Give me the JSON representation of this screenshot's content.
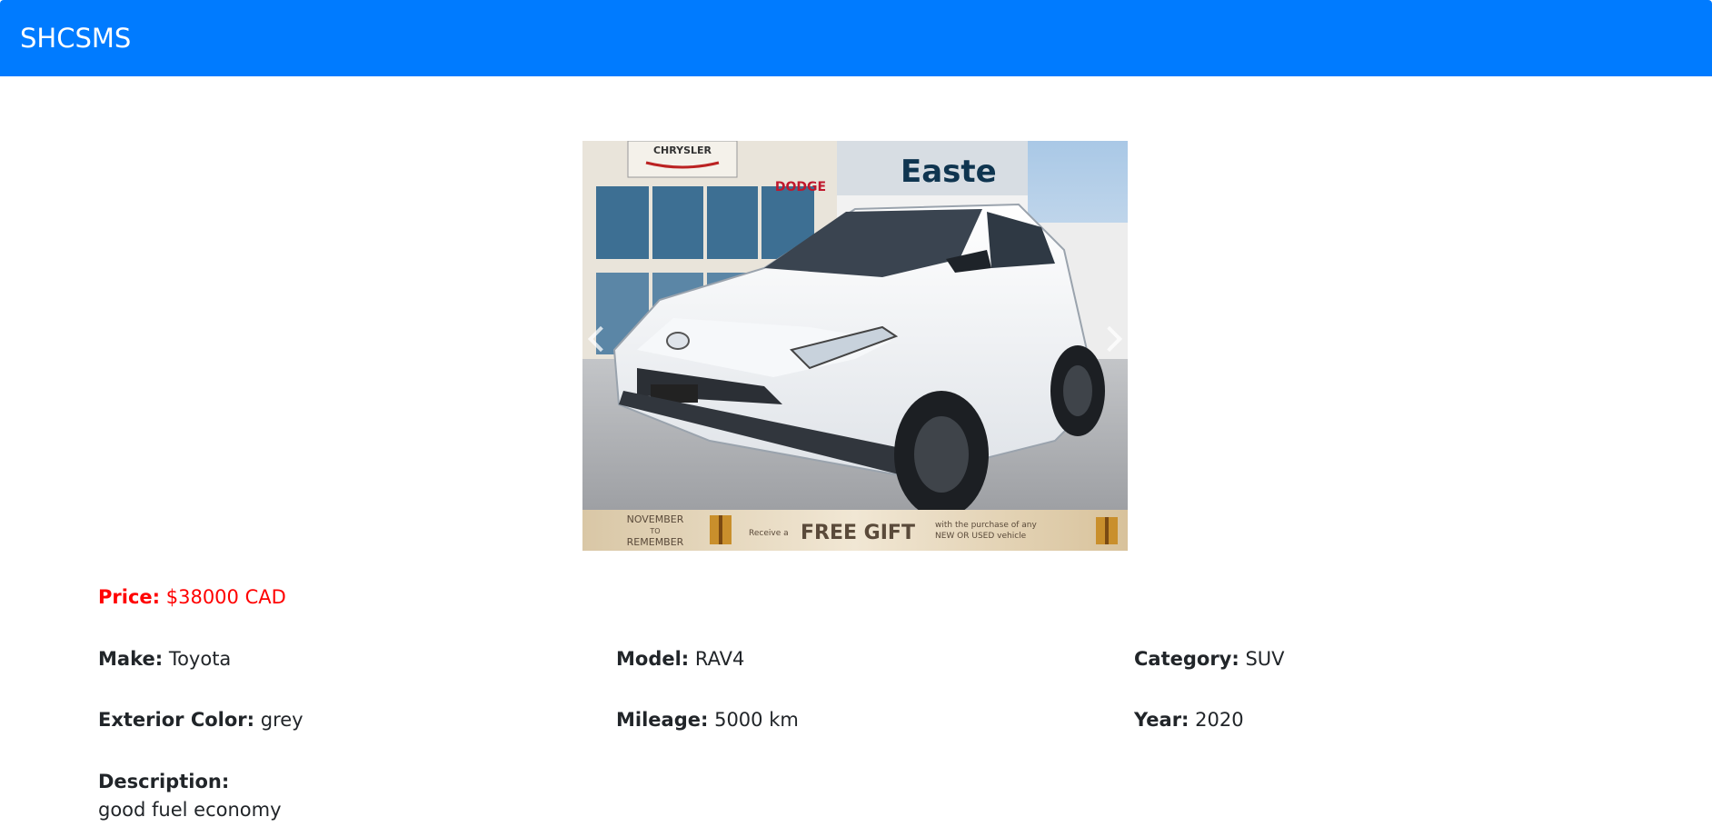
{
  "app": {
    "brand": "SHCSMS"
  },
  "banner": {
    "left_line1": "NOVEMBER",
    "left_line2": "TO",
    "left_line3": "REMEMBER",
    "receive": "Receive a",
    "headline": "FREE GIFT",
    "small_line1": "with the purchase of any",
    "small_line2": "NEW OR USED vehicle"
  },
  "signage": {
    "chrysler": "CHRYSLER",
    "dodge": "DODGE",
    "store": "Easte"
  },
  "listing": {
    "price_label": "Price:",
    "price_value": "$38000 CAD",
    "make_label": "Make:",
    "make_value": "Toyota",
    "model_label": "Model:",
    "model_value": "RAV4",
    "category_label": "Category:",
    "category_value": "SUV",
    "color_label": "Exterior Color:",
    "color_value": "grey",
    "mileage_label": "Mileage:",
    "mileage_value": "5000 km",
    "year_label": "Year:",
    "year_value": "2020",
    "description_label": "Description:",
    "description_value": "good fuel economy"
  },
  "colors": {
    "navbar": "#007bff",
    "price": "#ff0000",
    "text": "#212529"
  }
}
